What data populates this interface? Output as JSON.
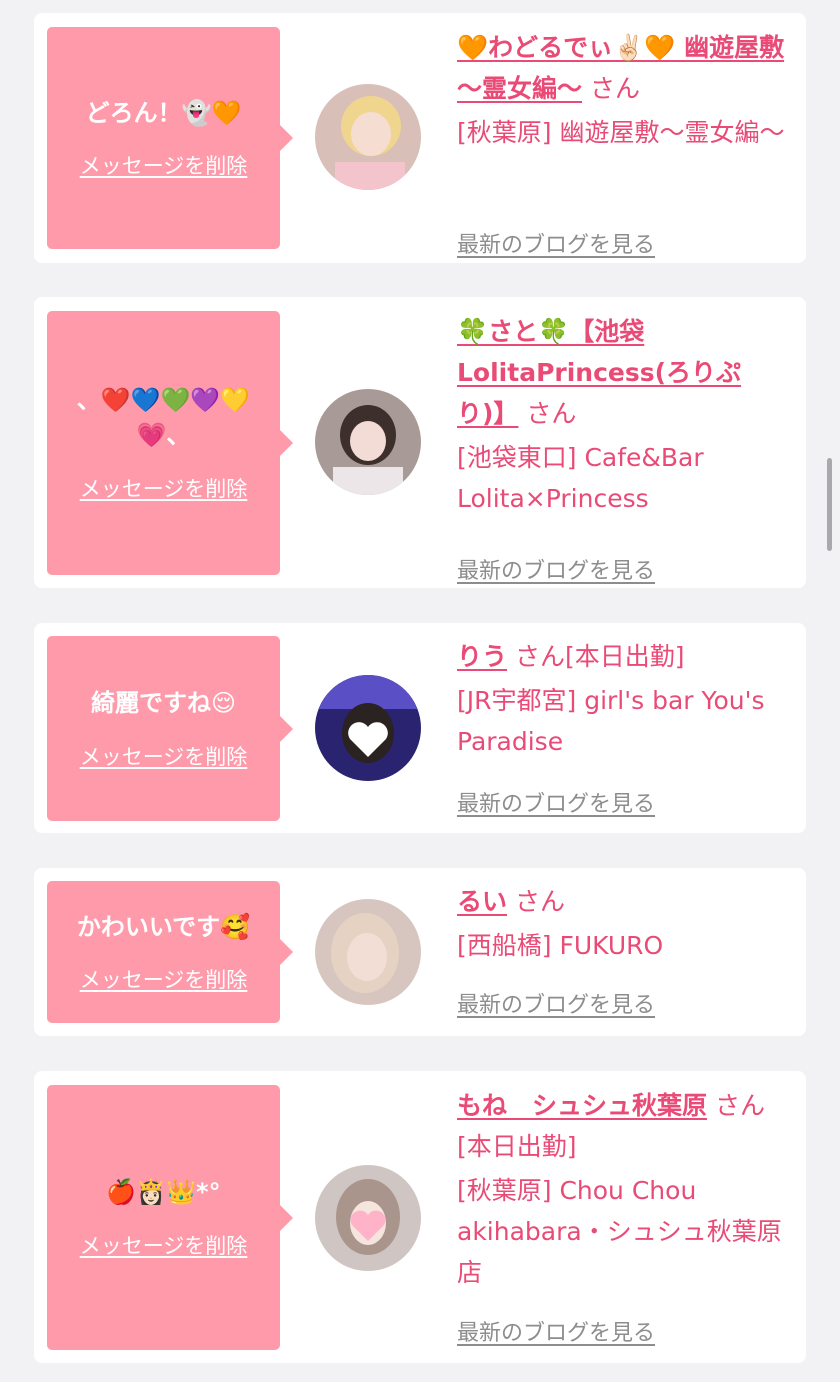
{
  "cards": [
    {
      "message": "どろん！👻🧡",
      "delete_label": "メッセージを削除",
      "name": "🧡わどるでぃ✌🏻🧡 幽遊屋敷 〜霊女編〜",
      "suffix": "さん",
      "shop": "[秋葉原] 幽遊屋敷〜霊女編〜",
      "blog_label": "最新のブログを見る"
    },
    {
      "message": "、❤️💙💚💜💛💗、",
      "delete_label": "メッセージを削除",
      "name": "🍀さと🍀【池袋LolitaPrincess(ろりぷり)】",
      "suffix": "さん",
      "shop": "[池袋東口] Cafe&Bar Lolita×Princess",
      "blog_label": "最新のブログを見る"
    },
    {
      "message": "綺麗ですね😌",
      "delete_label": "メッセージを削除",
      "name": "りう",
      "suffix": "さん[本日出勤]",
      "shop": "[JR宇都宮] girl's bar You's Paradise",
      "blog_label": "最新のブログを見る"
    },
    {
      "message": "かわいいです🥰",
      "delete_label": "メッセージを削除",
      "name": "るい",
      "suffix": "さん",
      "shop": "[西船橋] FUKURO",
      "blog_label": "最新のブログを見る"
    },
    {
      "message": "🍎👸🏻👑*°",
      "delete_label": "メッセージを削除",
      "name": "もね　シュシュ秋葉原",
      "suffix": "さん[本日出勤]",
      "shop": "[秋葉原] Chou Chou akihabara・シュシュ秋葉原店",
      "blog_label": "最新のブログを見る"
    }
  ],
  "colors": {
    "accent": "#e94b76",
    "bubble": "#ff9aaa",
    "background": "#f2f2f4",
    "muted": "#8d8d8d"
  }
}
